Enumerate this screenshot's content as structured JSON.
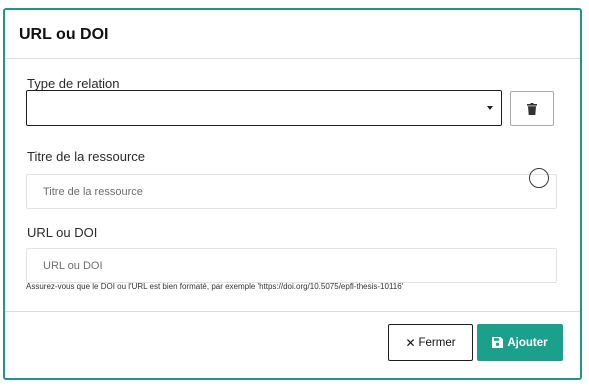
{
  "dialog": {
    "title": "URL ou DOI"
  },
  "relation": {
    "label": "Type de relation",
    "value": "",
    "delete_icon": "trash-icon"
  },
  "resource_title": {
    "label": "Titre de la ressource",
    "placeholder": "Titre de la ressource",
    "value": "",
    "status_icon": "loading-spinner-icon"
  },
  "url_doi": {
    "label": "URL ou DOI",
    "placeholder": "URL ou DOI",
    "value": "",
    "hint": "Assurez-vous que le DOI ou l'URL est bien formaté, par exemple 'https://doi.org/10.5075/epfl-thesis-10116'"
  },
  "footer": {
    "close_icon": "x-icon",
    "close_label": "Fermer",
    "add_icon": "save-icon",
    "add_label": "Ajouter"
  },
  "colors": {
    "accent": "#1ba08c",
    "border_accent": "#1a9a86"
  }
}
